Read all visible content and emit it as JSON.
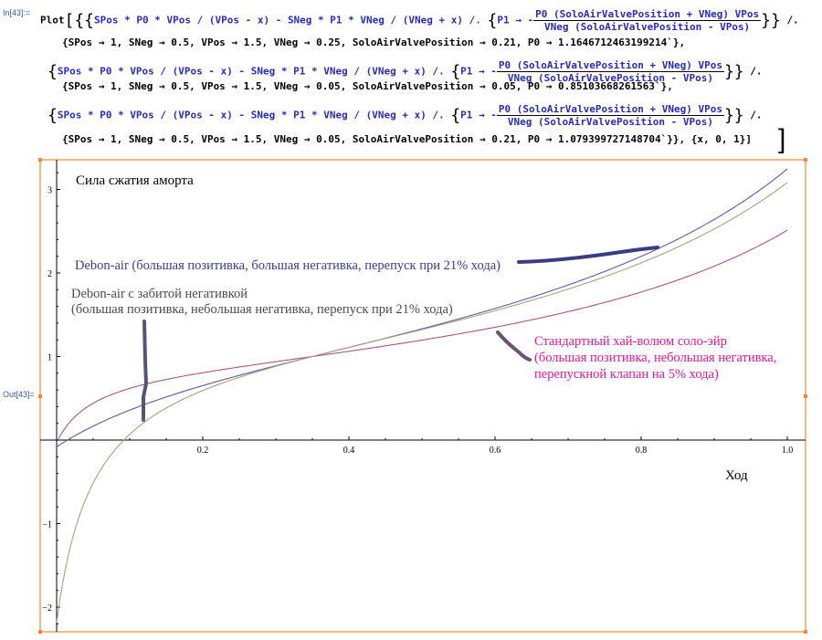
{
  "notebook": {
    "in_label": "In[43]:=",
    "out_label": "Out[43]=",
    "code": {
      "plot_head": "Plot",
      "expr": "SPos * P0 * VPos / (VPos - x) - SNeg * P1 * VNeg / (VNeg + x) /.",
      "p1_prefix": "P1 → -",
      "p1_num": "P0 (SoloAirValvePosition + VNeg) VPos",
      "p1_den": "VNeg (SoloAirValvePosition - VPos)",
      "rules": [
        "{SPos → 1, SNeg → 0.5, VPos → 1.5, VNeg → 0.25, SoloAirValvePosition → 0.21, P0 → 1.1646712463199214`},",
        "{SPos → 1, SNeg → 0.5, VPos → 1.5, VNeg → 0.05, SoloAirValvePosition → 0.05, P0 → 0.85103668261563`},",
        "{SPos → 1, SNeg → 0.5, VPos → 1.5, VNeg → 0.05, SoloAirValvePosition → 0.21, P0 → 1.079399727148704`}}, {x, 0, 1}]"
      ],
      "tail": "/."
    }
  },
  "chart_data": {
    "type": "line",
    "title": "Сила сжатия аморта",
    "xlabel": "Ход",
    "ylabel": "",
    "xlim": [
      0,
      1
    ],
    "ylim": [
      -2.3,
      3.3
    ],
    "x_ticks": [
      0.2,
      0.4,
      0.6,
      0.8,
      1.0
    ],
    "x_tick_labels": [
      "0.2",
      "0.4",
      "0.6",
      "0.8",
      "1.0"
    ],
    "y_ticks": [
      -2,
      -1,
      1,
      2,
      3
    ],
    "y_tick_labels": [
      "−2",
      "−1",
      "1",
      "2",
      "3"
    ],
    "grid": false,
    "formula": "SPos*P0*VPos/(VPos-x) - SNeg*P1*VNeg/(VNeg+x), P1 = -P0*(SoloAirValvePosition+VNeg)*VPos/(VNeg*(SoloAirValvePosition-VPos))",
    "series": [
      {
        "name": "Debon-air (большая позитивка, большая негативка, перепуск при 21% хода)",
        "color": "#5b5ba6",
        "params": {
          "SPos": 1,
          "SNeg": 0.5,
          "VPos": 1.5,
          "VNeg": 0.25,
          "SoloAirValvePosition": 0.21,
          "P0": 1.1646712463199214
        },
        "x": [
          0,
          0.1,
          0.2,
          0.3,
          0.4,
          0.5,
          0.6,
          0.7,
          0.8,
          0.9,
          1.0
        ],
        "values": [
          -0.08,
          0.41,
          0.71,
          0.92,
          1.11,
          1.29,
          1.48,
          1.71,
          2.0,
          2.4,
          3.25
        ]
      },
      {
        "name": "Стандартный хай-волюм соло-эйр (большая позитивка, небольшая негативка, перепускной клапан на 5% хода)",
        "color": "#a4587f",
        "params": {
          "SPos": 1,
          "SNeg": 0.5,
          "VPos": 1.5,
          "VNeg": 0.05,
          "SoloAirValvePosition": 0.05,
          "P0": 0.85103668261563
        },
        "x": [
          0,
          0.1,
          0.2,
          0.3,
          0.4,
          0.5,
          0.6,
          0.7,
          0.8,
          0.9,
          1.0
        ],
        "values": [
          -0.03,
          0.62,
          0.79,
          0.9,
          1.01,
          1.14,
          1.29,
          1.48,
          1.73,
          2.06,
          2.51
        ]
      },
      {
        "name": "Debon-air с забитой негативкой (большая позитивка, небольшая негативка, перепуск при 21% хода)",
        "color": "#ab9f80",
        "params": {
          "SPos": 1,
          "SNeg": 0.5,
          "VPos": 1.5,
          "VNeg": 0.05,
          "SoloAirValvePosition": 0.21,
          "P0": 1.079399727148704
        },
        "x": [
          0,
          0.1,
          0.2,
          0.3,
          0.4,
          0.5,
          0.6,
          0.7,
          0.8,
          0.9,
          1.0
        ],
        "values": [
          -2.18,
          0.07,
          0.62,
          0.9,
          1.12,
          1.34,
          1.57,
          1.84,
          2.16,
          2.54,
          3.08
        ]
      }
    ],
    "annotations": [
      {
        "text": "Сила сжатия аморта",
        "color": "#000000"
      },
      {
        "text": "Debon-air (большая позитивка, большая негативка, перепуск при 21% хода)",
        "color": "#3b3b8c"
      },
      {
        "text": "Debon-air с забитой негативкой",
        "color": "#4a4a4a"
      },
      {
        "text": "(большая позитивка, небольшая негативка, перепуск при 21% хода)",
        "color": "#4a4a4a"
      },
      {
        "text": "Стандартный хай-волюм соло-эйр",
        "color": "#e0189a"
      },
      {
        "text": "(большая позитивка, небольшая негативка,",
        "color": "#e0189a"
      },
      {
        "text": "перепускной клапан на 5% хода)",
        "color": "#e0189a"
      },
      {
        "text": "Ход",
        "color": "#000000"
      }
    ]
  },
  "colors": {
    "cell_bracket": "#f0883a",
    "code_blue": "#2a2ab8",
    "axis": "#000000",
    "marker_stroke": "#4a4a78"
  }
}
